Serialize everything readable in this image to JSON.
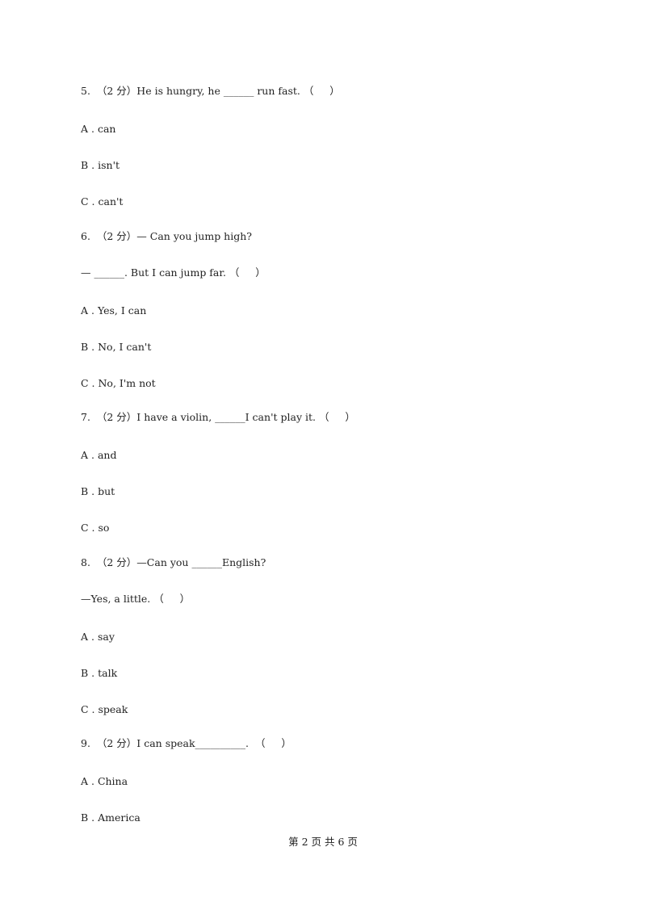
{
  "questions": [
    {
      "number": "5.",
      "points": "（2 分）",
      "stem": "5.  （2 分）He is hungry, he ______ run fast. （     ）",
      "options": [
        "A . can",
        "B . isn't",
        "C . can't"
      ]
    },
    {
      "number": "6.",
      "points": "（2 分）",
      "stem": "6.  （2 分）— Can you jump high?",
      "stem2": "— ______. But I can jump far. （     ）",
      "options": [
        "A . Yes, I can",
        "B . No, I can't",
        "C . No, I'm not"
      ]
    },
    {
      "number": "7.",
      "points": "（2 分）",
      "stem": "7.  （2 分）I have a violin, ______I can't play it. （     ）",
      "options": [
        "A . and",
        "B . but",
        "C . so"
      ]
    },
    {
      "number": "8.",
      "points": "（2 分）",
      "stem": "8.  （2 分）—Can you ______English?",
      "stem2": "—Yes, a little. （     ）",
      "options": [
        "A . say",
        "B . talk",
        "C . speak"
      ]
    },
    {
      "number": "9.",
      "points": "（2 分）",
      "stem": "9.  （2 分）I can speak__________.  （     ）",
      "options": [
        "A . China",
        "B . America"
      ]
    }
  ],
  "footer": "第 2 页 共 6 页"
}
